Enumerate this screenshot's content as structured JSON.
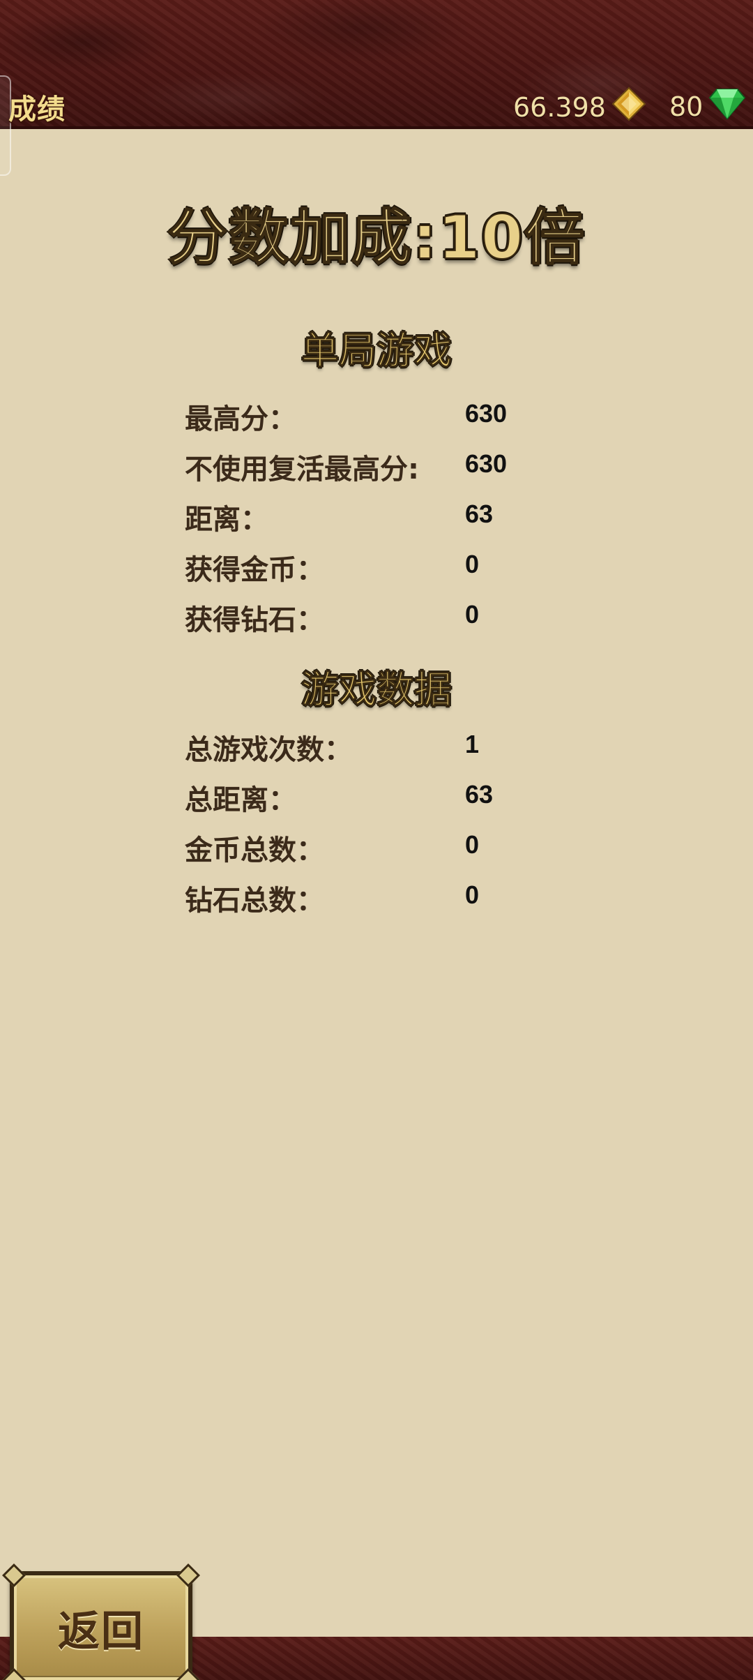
{
  "topbar": {
    "title": "成绩",
    "gold_amount": "66.398",
    "gem_amount": "80",
    "gold_icon": "gold-diamond-icon",
    "gem_icon": "green-gem-icon"
  },
  "bonus_title": "分数加成:10倍",
  "single_game": {
    "heading": "单局游戏",
    "rows": [
      {
        "label": "最高分：",
        "value": "630"
      },
      {
        "label": "不使用复活最高分:",
        "value": "630"
      },
      {
        "label": "距离：",
        "value": "63"
      },
      {
        "label": "获得金币：",
        "value": "0"
      },
      {
        "label": "获得钻石：",
        "value": "0"
      }
    ]
  },
  "game_stats": {
    "heading": "游戏数据",
    "rows": [
      {
        "label": "总游戏次数：",
        "value": "1"
      },
      {
        "label": "总距离：",
        "value": "63"
      },
      {
        "label": "金币总数：",
        "value": "0"
      },
      {
        "label": "钻石总数：",
        "value": "0"
      }
    ]
  },
  "back_button": {
    "label": "返回"
  },
  "colors": {
    "background": "#e1d4b4",
    "leather": "#4a1512",
    "gold_text": "#e8d08a"
  }
}
